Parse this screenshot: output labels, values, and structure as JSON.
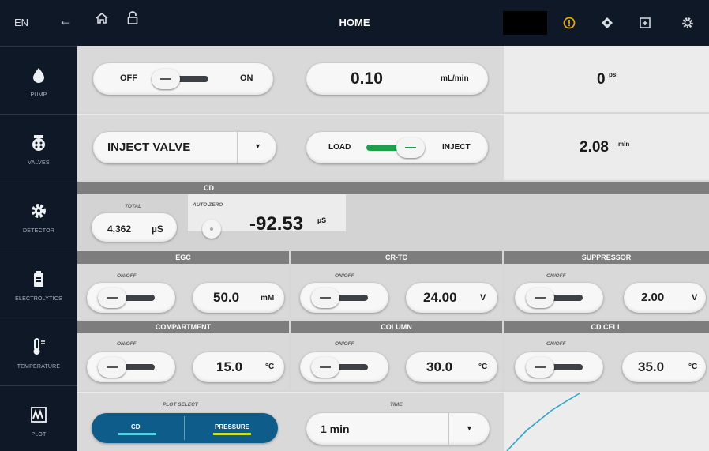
{
  "topbar": {
    "lang": "EN",
    "title": "HOME",
    "icons": [
      "back-arrow-icon",
      "home-icon",
      "lock-icon",
      "alert-icon",
      "diamond-icon",
      "add-box-icon",
      "settings-icon"
    ],
    "alert_color": "#e8a800"
  },
  "sidebar": {
    "items": [
      {
        "label": "PUMP",
        "icon": "drop-icon"
      },
      {
        "label": "VALVES",
        "icon": "valve-icon"
      },
      {
        "label": "DETECTOR",
        "icon": "detector-icon"
      },
      {
        "label": "ELECTROLYTICS",
        "icon": "battery-icon"
      },
      {
        "label": "TEMPERATURE",
        "icon": "thermometer-icon"
      },
      {
        "label": "PLOT",
        "icon": "plot-icon"
      }
    ]
  },
  "pump": {
    "off_label": "OFF",
    "on_label": "ON",
    "flow_value": "0.10",
    "flow_unit": "mL/min",
    "pressure_value": "0",
    "pressure_unit": "psi"
  },
  "valves": {
    "select_value": "INJECT VALVE",
    "load_label": "LOAD",
    "inject_label": "INJECT",
    "time_value": "2.08",
    "time_unit": "min"
  },
  "cd": {
    "header": "CD",
    "total_label": "TOTAL",
    "total_value": "4,362",
    "total_unit": "µS",
    "auto_zero_label": "AUTO ZERO",
    "reading_value": "-92.53",
    "reading_unit": "µS"
  },
  "electrolytics": {
    "egc": {
      "header": "EGC",
      "onoff_label": "ON/OFF",
      "value": "50.0",
      "unit": "mM"
    },
    "crtc": {
      "header": "CR-TC",
      "onoff_label": "ON/OFF",
      "value": "24.00",
      "unit": "V"
    },
    "suppressor": {
      "header": "SUPPRESSOR",
      "onoff_label": "ON/OFF",
      "value": "2.00",
      "unit": "V"
    }
  },
  "temperature": {
    "compartment": {
      "header": "COMPARTMENT",
      "onoff_label": "ON/OFF",
      "value": "15.0",
      "unit": "°C"
    },
    "column": {
      "header": "COLUMN",
      "onoff_label": "ON/OFF",
      "value": "30.0",
      "unit": "°C"
    },
    "cdcell": {
      "header": "CD CELL",
      "onoff_label": "ON/OFF",
      "value": "35.0",
      "unit": "°C"
    }
  },
  "plot": {
    "plot_select_label": "PLOT SELECT",
    "cd_label": "CD",
    "pressure_label": "PRESSURE",
    "time_label": "TIME",
    "time_value": "1 min",
    "cd_color": "#5ad0e6",
    "pressure_color": "#c6df2e",
    "accent": "#0d5c8a",
    "trace_color": "#2aa8cc"
  }
}
